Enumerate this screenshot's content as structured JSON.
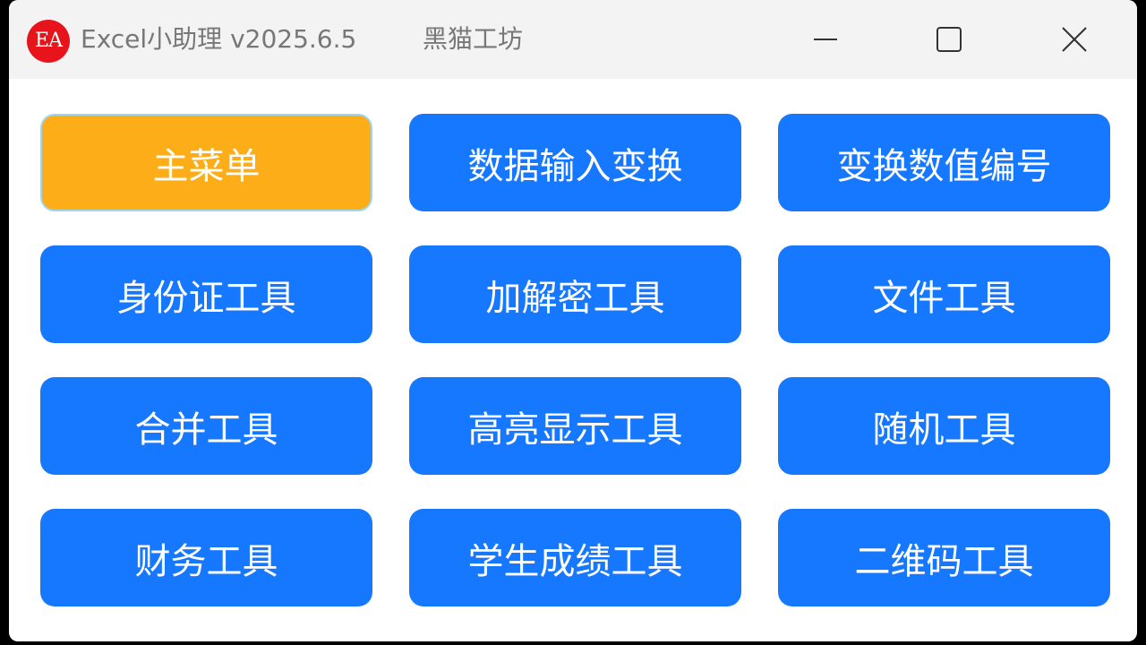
{
  "window": {
    "logo_text": "EA",
    "title": "Excel小助理 v2025.6.5",
    "author": "黑猫工坊",
    "controls": [
      "minimize",
      "maximize",
      "close"
    ]
  },
  "buttons": [
    {
      "label": "主菜单",
      "active": true
    },
    {
      "label": "数据输入变换",
      "active": false
    },
    {
      "label": "变换数值编号",
      "active": false
    },
    {
      "label": "身份证工具",
      "active": false
    },
    {
      "label": "加解密工具",
      "active": false
    },
    {
      "label": "文件工具",
      "active": false
    },
    {
      "label": "合并工具",
      "active": false
    },
    {
      "label": "高亮显示工具",
      "active": false
    },
    {
      "label": "随机工具",
      "active": false
    },
    {
      "label": "财务工具",
      "active": false
    },
    {
      "label": "学生成绩工具",
      "active": false
    },
    {
      "label": "二维码工具",
      "active": false
    }
  ],
  "colors": {
    "button_blue": "#1677ff",
    "button_active": "#fcad17",
    "logo_red": "#e8141c",
    "titlebar_bg": "#f3f3f3",
    "title_text": "#777777"
  }
}
